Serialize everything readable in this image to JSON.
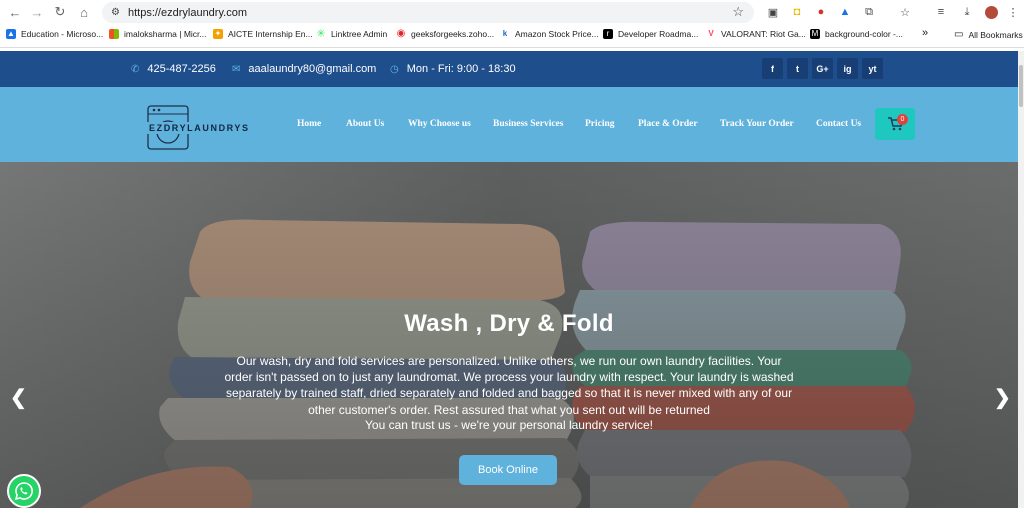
{
  "browser": {
    "url": "https://ezdrylaundry.com",
    "bookmarks": [
      {
        "label": "Education - Microso...",
        "icon": "edge-icon",
        "color": "#1a73e8"
      },
      {
        "label": "imaloksharma | Micr...",
        "icon": "microsoft-icon",
        "color": "#f25022"
      },
      {
        "label": "AICTE Internship En...",
        "icon": "aicte-icon",
        "color": "#f4a100"
      },
      {
        "label": "Linktree Admin",
        "icon": "linktree-icon",
        "color": "#43e660"
      },
      {
        "label": "geeksforgeeks.zoho...",
        "icon": "zoho-icon",
        "color": "#e42527"
      },
      {
        "label": "Amazon Stock Price...",
        "icon": "k-icon",
        "color": "#1b6ac9"
      },
      {
        "label": "Developer Roadma...",
        "icon": "roadmap-icon",
        "color": "#000000"
      },
      {
        "label": "VALORANT: Riot Ga...",
        "icon": "valorant-icon",
        "color": "#ff4655"
      },
      {
        "label": "background-color -...",
        "icon": "mdn-icon",
        "color": "#000000"
      }
    ],
    "more_bookmarks": "»",
    "all_bookmarks": "All Bookmarks"
  },
  "topbar": {
    "phone": "425-487-2256",
    "email": "aaalaundry80@gmail.com",
    "hours": "Mon - Fri: 9:00 - 18:30",
    "social": [
      "f",
      "t",
      "G+",
      "ig",
      "yt"
    ]
  },
  "header": {
    "logo_text": "EZDRYLAUNDRYS",
    "menu": [
      "Home",
      "About Us",
      "Why Choose us",
      "Business Services",
      "Pricing",
      "Place & Order",
      "Track Your Order",
      "Contact Us"
    ],
    "cart_count": "0"
  },
  "hero": {
    "title": "Wash , Dry & Fold",
    "description": "Our wash, dry and fold services are personalized. Unlike others, we run our own laundry facilities. Your order isn't passed on to just any laundromat. We process your laundry with respect. Your laundry is washed separately by trained staff, dried separately and folded and bagged so that it is never mixed with any of our other customer's order. Rest assured that what you sent out will be returned",
    "tagline": "You can trust us - we're your personal laundry service!",
    "button": "Book Online",
    "prev": "❮",
    "next": "❯"
  },
  "colors": {
    "topbar": "#1e4e8c",
    "header": "#5fb2dc",
    "cart": "#1fc8be",
    "whatsapp": "#25d366"
  }
}
